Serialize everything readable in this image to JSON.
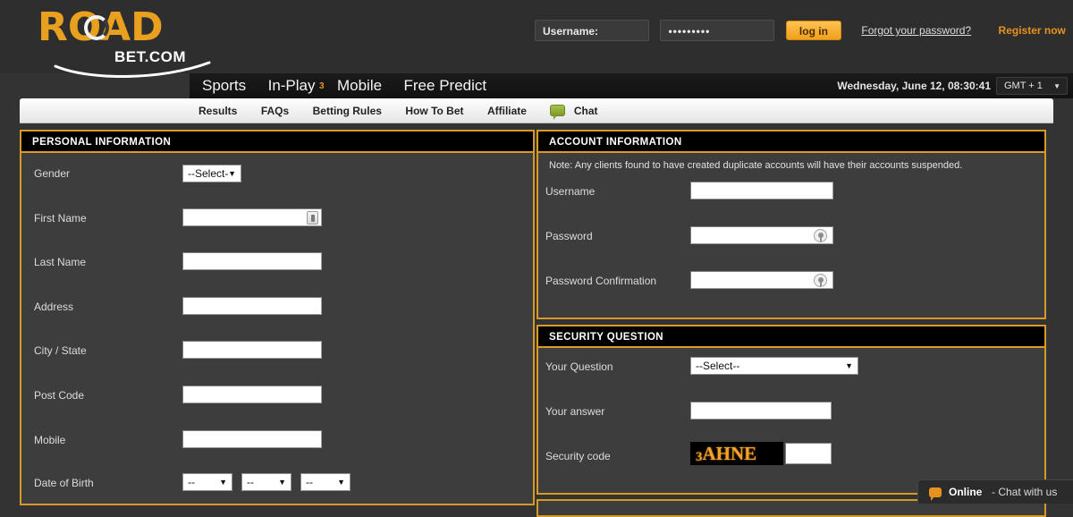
{
  "brand": {
    "logo_main": "ROAD",
    "logo_sub": "BET.COM"
  },
  "header": {
    "username_value": "Username:",
    "password_value": "•••••••••",
    "login_label": "log in",
    "forgot_label": "Forgot your password?",
    "register_label": "Register now",
    "dots": "..."
  },
  "mainnav": {
    "items": [
      {
        "label": "Sports",
        "sup": ""
      },
      {
        "label": "In-Play",
        "sup": "3"
      },
      {
        "label": "Mobile",
        "sup": ""
      },
      {
        "label": "Free Predict",
        "sup": ""
      }
    ],
    "datetime": "Wednesday, June 12,  08:30:41",
    "timezone": "GMT + 1",
    "timezone_arrow": "▼"
  },
  "subnav": {
    "items": [
      "Results",
      "FAQs",
      "Betting Rules",
      "How To Bet",
      "Affiliate"
    ],
    "chat_label": "Chat"
  },
  "personal": {
    "title": "PERSONAL INFORMATION",
    "gender_label": "Gender",
    "gender_value": "--Select-",
    "first_name_label": "First Name",
    "last_name_label": "Last Name",
    "address_label": "Address",
    "city_label": "City / State",
    "post_code_label": "Post Code",
    "mobile_label": "Mobile",
    "dob_label": "Date of Birth",
    "dob_day": "--",
    "dob_month": "--",
    "dob_year": "--",
    "arrow": "▼"
  },
  "account": {
    "title": "ACCOUNT INFORMATION",
    "note": "Note: Any clients found to have created duplicate accounts will have their accounts suspended.",
    "username_label": "Username",
    "password_label": "Password",
    "password_confirm_label": "Password Confirmation"
  },
  "security": {
    "title": "SECURITY QUESTION",
    "question_label": "Your Question",
    "question_value": "--Select--",
    "answer_label": "Your answer",
    "code_label": "Security code",
    "captcha_small": "3",
    "captcha_text": "AHNE",
    "arrow": "▼"
  },
  "chat_widget": {
    "status": "Online",
    "rest": "- Chat with us"
  },
  "colors": {
    "accent": "#e8921e",
    "panel_border": "#d79a24",
    "panel_bg": "#3d3d3d",
    "page_bg": "#333333",
    "captcha_text": "#f0a32a"
  }
}
